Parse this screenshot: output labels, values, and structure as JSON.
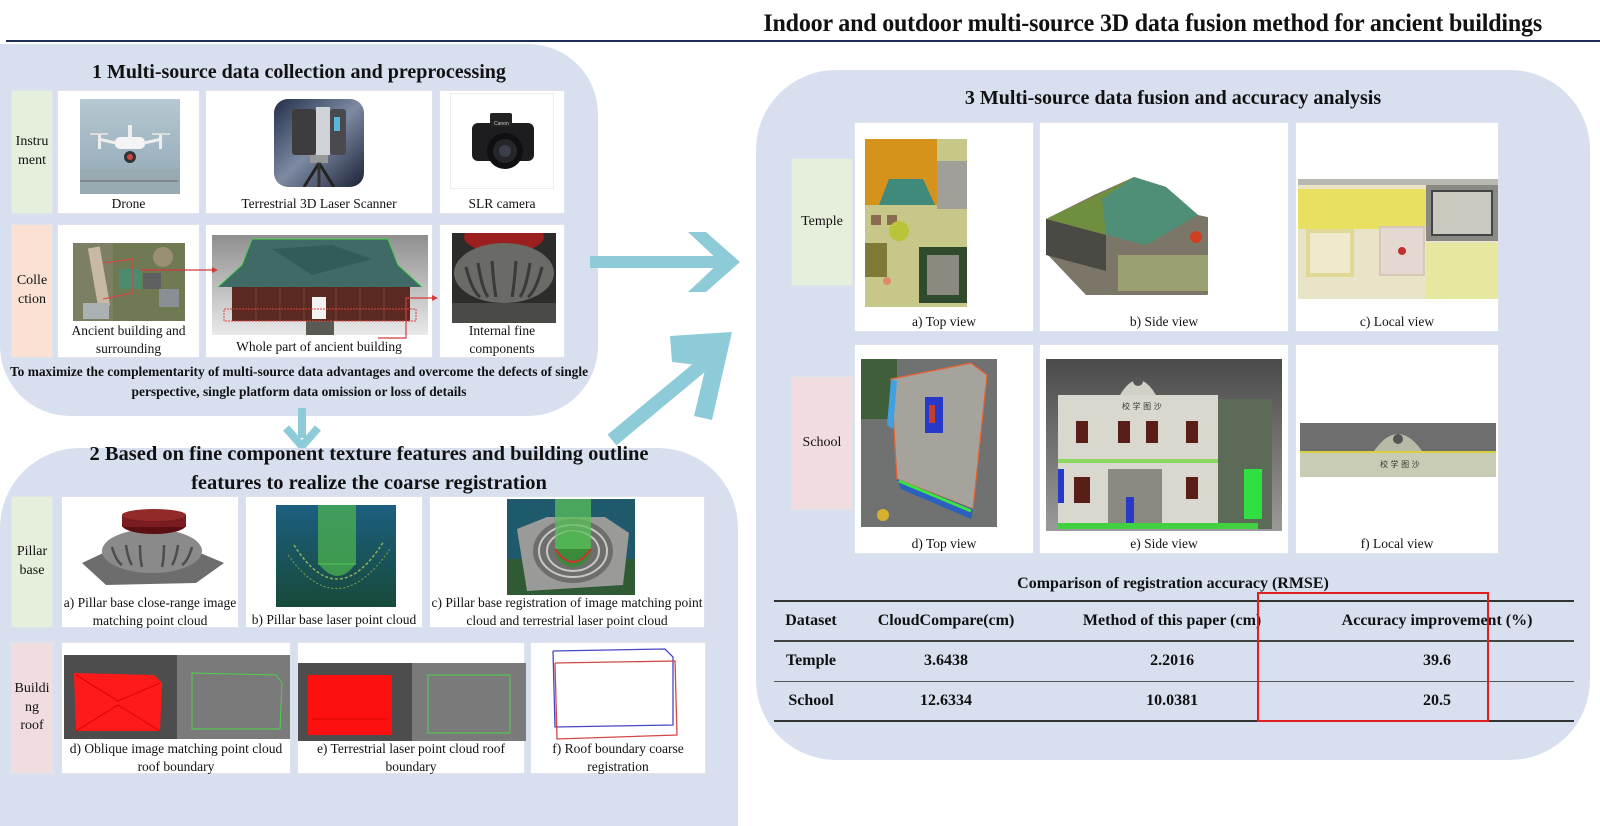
{
  "title": "Indoor and outdoor multi-source 3D data fusion method for ancient buildings",
  "colors": {
    "panel_bg": "#d8e0f0",
    "title_rule": "#1f2e55",
    "arrow": "#8ecbd8",
    "label_green": "#e6eedc",
    "label_peach": "#fae1d3",
    "label_pink": "#f1dcdf",
    "highlight_box": "#e02020"
  },
  "section1": {
    "title": "1 Multi-source data collection and preprocessing",
    "rows": [
      {
        "label": "Instru ment",
        "items": [
          {
            "caption": "Drone",
            "image": "drone-photo"
          },
          {
            "caption": "Terrestrial 3D Laser Scanner",
            "image": "laser-scanner-photo"
          },
          {
            "caption": "SLR camera",
            "image": "slr-camera-photo"
          }
        ]
      },
      {
        "label": "Colle ction",
        "items": [
          {
            "caption": "Ancient building and surrounding",
            "image": "aerial-site-photo"
          },
          {
            "caption": "Whole part of ancient building",
            "image": "building-point-cloud"
          },
          {
            "caption": "Internal fine components",
            "image": "pillar-base-photo"
          }
        ]
      }
    ],
    "note": "To maximize the complementarity of multi-source data advantages and overcome the defects of single perspective, single platform data omission or loss of details"
  },
  "section2": {
    "title_line1": "2 Based on fine component texture features and building outline",
    "title_line2": "features to realize the coarse registration",
    "rows": [
      {
        "label": "Pillar base",
        "items": [
          {
            "caption": "a) Pillar base close-range image matching point cloud",
            "image": "pillar-image-matching-cloud"
          },
          {
            "caption": "b) Pillar base laser point cloud",
            "image": "pillar-laser-cloud"
          },
          {
            "caption": "c) Pillar base registration of image matching point cloud and terrestrial laser point cloud",
            "image": "pillar-registration"
          }
        ]
      },
      {
        "label": "Buildi ng roof",
        "items": [
          {
            "caption": "d) Oblique image matching point cloud roof boundary",
            "image": "oblique-roof-boundary"
          },
          {
            "caption": "e) Terrestrial laser point cloud roof boundary",
            "image": "laser-roof-boundary"
          },
          {
            "caption": "f) Roof boundary coarse registration",
            "image": "roof-boundary-registration"
          }
        ]
      }
    ]
  },
  "section3": {
    "title": "3 Multi-source data fusion and accuracy analysis",
    "rows": [
      {
        "label": "Temple",
        "items": [
          {
            "caption": "a) Top view",
            "image": "temple-top-view"
          },
          {
            "caption": "b) Side view",
            "image": "temple-side-view"
          },
          {
            "caption": "c) Local view",
            "image": "temple-local-view"
          }
        ]
      },
      {
        "label": "School",
        "items": [
          {
            "caption": "d) Top view",
            "image": "school-top-view"
          },
          {
            "caption": "e) Side view",
            "image": "school-side-view"
          },
          {
            "caption": "f) Local view",
            "image": "school-local-view"
          }
        ]
      }
    ],
    "table": {
      "caption": "Comparison of registration accuracy (RMSE)",
      "headers": [
        "Dataset",
        "CloudCompare(cm)",
        "Method of this paper (cm)",
        "Accuracy improvement (%)"
      ],
      "rows": [
        [
          "Temple",
          "3.6438",
          "2.2016",
          "39.6"
        ],
        [
          "School",
          "12.6334",
          "10.0381",
          "20.5"
        ]
      ],
      "highlighted_column": "Accuracy improvement (%)"
    }
  },
  "chart_data": {
    "type": "table",
    "title": "Comparison of registration accuracy (RMSE)",
    "columns": [
      "Dataset",
      "CloudCompare(cm)",
      "Method of this paper (cm)",
      "Accuracy improvement (%)"
    ],
    "rows": [
      {
        "Dataset": "Temple",
        "CloudCompare(cm)": 3.6438,
        "Method of this paper (cm)": 2.2016,
        "Accuracy improvement (%)": 39.6
      },
      {
        "Dataset": "School",
        "CloudCompare(cm)": 12.6334,
        "Method of this paper (cm)": 10.0381,
        "Accuracy improvement (%)": 20.5
      }
    ]
  }
}
